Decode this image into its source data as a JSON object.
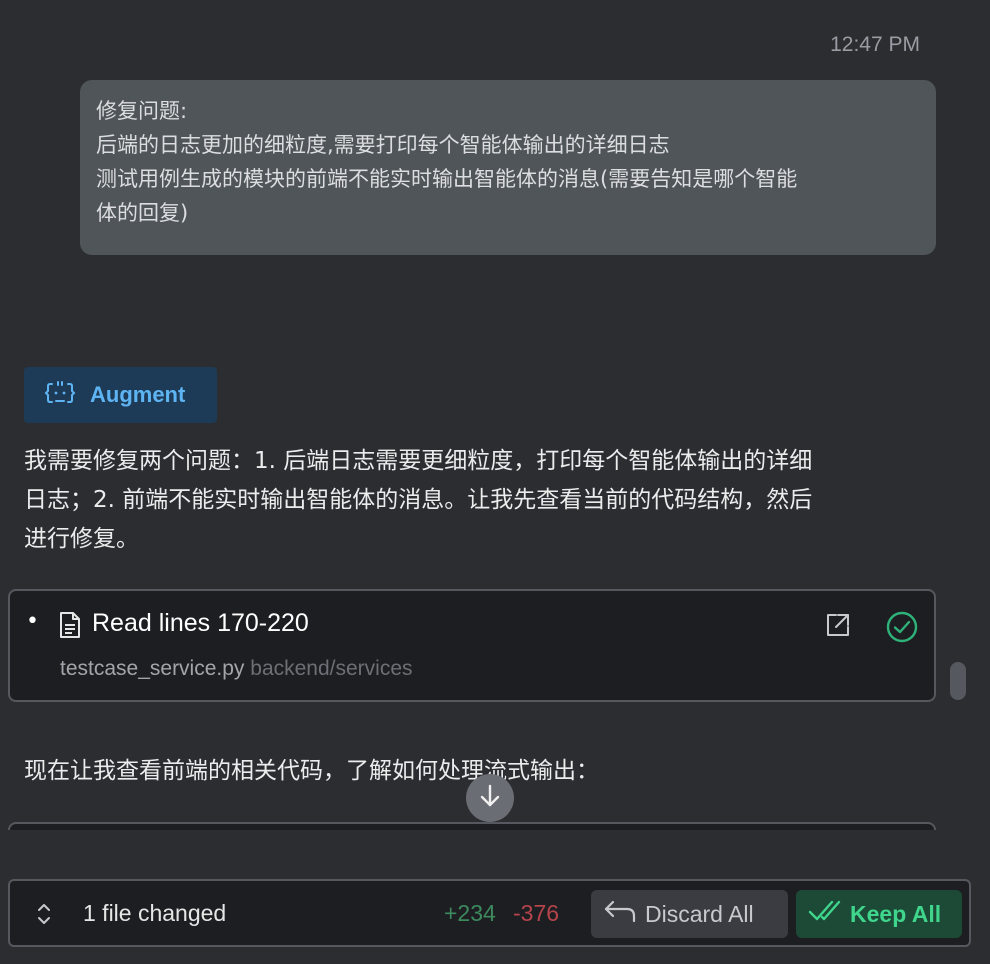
{
  "message": {
    "timestamp": "12:47 PM",
    "user_lines": [
      "修复问题:",
      "后端的日志更加的细粒度,需要打印每个智能体输出的详细日志",
      "测试用例生成的模块的前端不能实时输出智能体的消息(需要告知是哪个智能",
      "体的回复)"
    ]
  },
  "agent": {
    "name": "Augment",
    "icon": "agent-bot-icon",
    "color": "#5eb4f2",
    "reply_lines": [
      "我需要修复两个问题：1. 后端日志需要更细粒度，打印每个智能体输出的详细",
      "日志；2. 前端不能实时输出智能体的消息。让我先查看当前的代码结构，然后",
      "进行修复。"
    ]
  },
  "tool_call": {
    "title": "Read lines 170-220",
    "file": "testcase_service.py",
    "dir": "backend/services",
    "status": "success",
    "status_color": "#2fb27a"
  },
  "next_message": "现在让我查看前端的相关代码，了解如何处理流式输出：",
  "changes": {
    "summary": "1 file changed",
    "added": "+234",
    "removed": "-376",
    "discard_label": "Discard All",
    "keep_label": "Keep All"
  }
}
